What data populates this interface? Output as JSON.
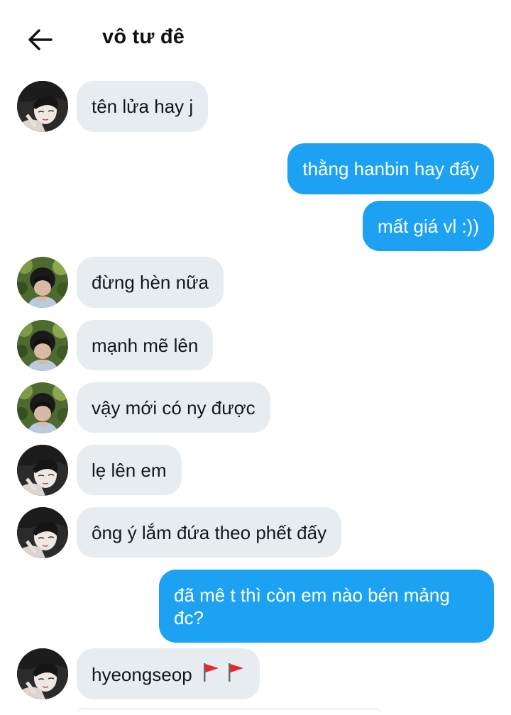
{
  "header": {
    "title": "vô tư đê",
    "back_icon": "arrow-left-icon"
  },
  "messages": [
    {
      "side": "in",
      "avatar": "person-a",
      "text": "tên lửa hay j"
    },
    {
      "side": "out",
      "text": "thằng hanbin hay đấy"
    },
    {
      "side": "out",
      "text": "mất giá vl :))"
    },
    {
      "side": "in",
      "avatar": "person-b",
      "text": "đừng hèn nữa"
    },
    {
      "side": "in",
      "avatar": "person-b",
      "text": "mạnh mẽ lên"
    },
    {
      "side": "in",
      "avatar": "person-b",
      "text": "vậy mới có ny được"
    },
    {
      "side": "in",
      "avatar": "person-a",
      "text": "lẹ lên em"
    },
    {
      "side": "in",
      "avatar": "person-a",
      "text": "ông ý lắm đứa theo phết đấy"
    },
    {
      "side": "out",
      "text": "đã mê t thì còn em nào bén mảng đc?"
    },
    {
      "side": "in",
      "avatar": "person-a",
      "text": "hyeongseop",
      "emoji": [
        "red-flag-icon",
        "red-flag-icon"
      ]
    }
  ],
  "colors": {
    "incoming_bubble": "#e7ecf0",
    "outgoing_bubble": "#1da1f2",
    "outgoing_text": "#ffffff"
  }
}
